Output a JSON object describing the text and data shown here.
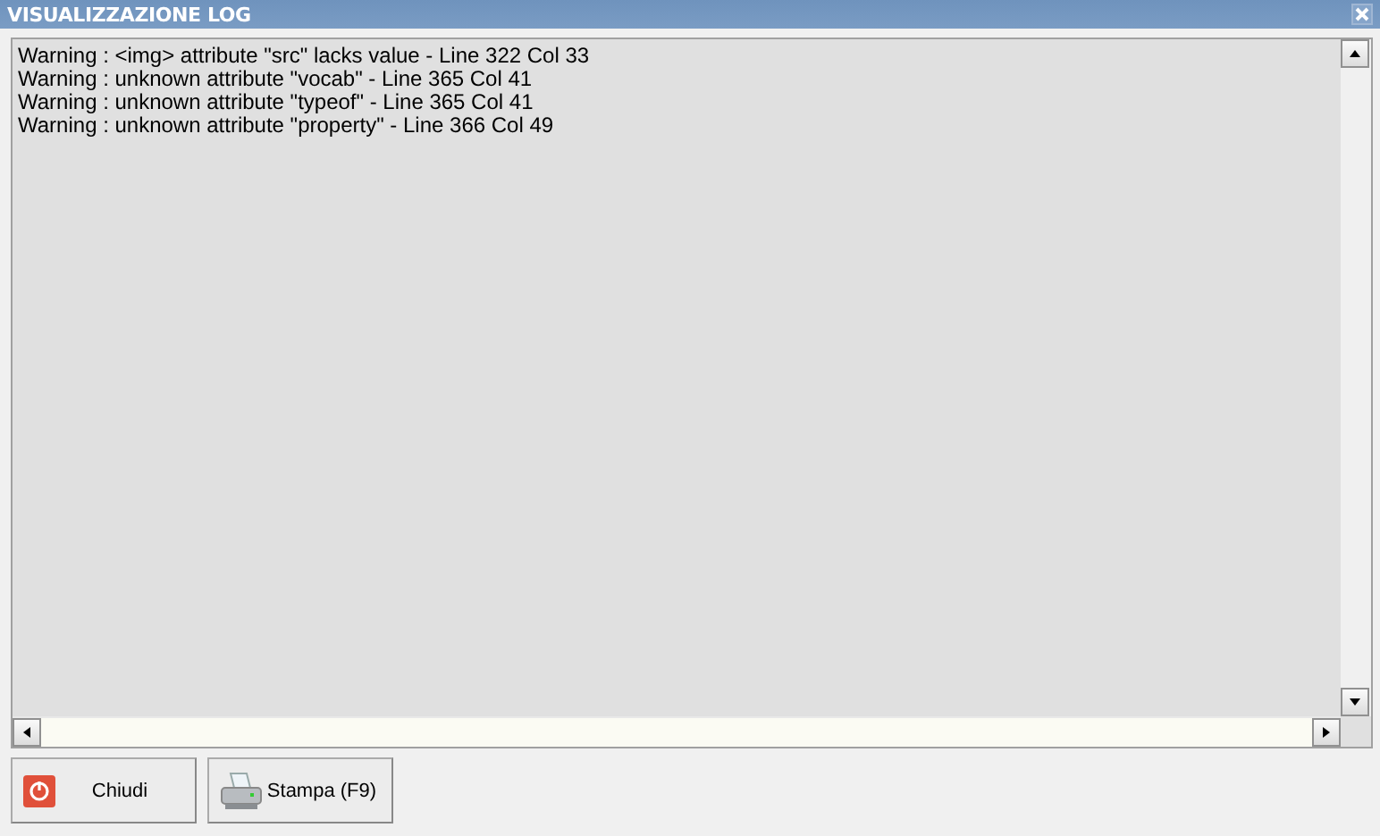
{
  "window": {
    "title": "VISUALIZZAZIONE LOG"
  },
  "log": {
    "lines": [
      "Warning : <img> attribute \"src\" lacks value - Line 322 Col 33",
      "Warning : unknown attribute \"vocab\" - Line 365 Col 41",
      "Warning : unknown attribute \"typeof\" - Line 365 Col 41",
      "Warning : unknown attribute \"property\" - Line 366 Col 49"
    ]
  },
  "buttons": [
    {
      "label": "Chiudi",
      "kind": "close"
    },
    {
      "label": "Stampa (F9)",
      "kind": "print"
    }
  ]
}
